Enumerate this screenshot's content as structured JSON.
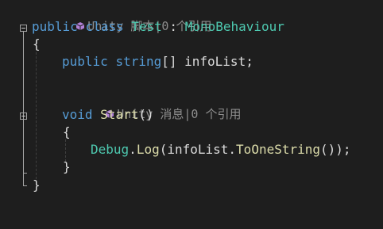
{
  "editor": {
    "class_lens": "Unity 脚本|0 个引用",
    "method_lens": "Unity 消息|0 个引用",
    "line1": {
      "kw1": "public",
      "kw2": "class",
      "class_name": "Test",
      "colon": " : ",
      "base_type": "MonoBehaviour"
    },
    "open_brace_1": "{",
    "line3": {
      "kw1": "public",
      "kw2": "string",
      "rest": "[] infoList;"
    },
    "line5": {
      "kw": "void",
      "method": "Start",
      "parens": "()"
    },
    "open_brace_2": "{",
    "line7": {
      "type": "Debug",
      "dot1": ".",
      "method1": "Log",
      "mid": "(infoList.",
      "method2": "ToOneString",
      "end": "());"
    },
    "close_brace_2": "}",
    "close_brace_1": "}",
    "lens_icon_color": "#b180d7"
  }
}
